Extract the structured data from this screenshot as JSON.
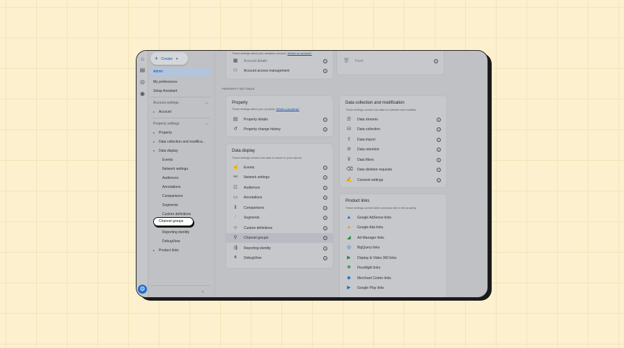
{
  "colors": {
    "background": "#fcf0cf",
    "accent": "#1f6fd1",
    "frame": "#bfc1c4"
  },
  "rail": {
    "icons": [
      "home-icon",
      "reports-icon",
      "explore-icon",
      "advertising-icon"
    ],
    "settings_icon": "gear-icon"
  },
  "sidebar": {
    "create_label": "Create",
    "admin": "Admin",
    "my_preferences": "My preferences",
    "setup_assistant": "Setup Assistant",
    "account_settings": "Account settings",
    "account": "Account",
    "property_settings": "Property settings",
    "property": "Property",
    "data_collection": "Data collection and modifica...",
    "data_display": "Data display",
    "sub_items": [
      "Events",
      "Network settings",
      "Audiences",
      "Annotations",
      "Comparisons",
      "Segments",
      "Custom definitions",
      "Channel groups",
      "Reporting identity",
      "DebugView"
    ],
    "product_links": "Product links"
  },
  "top_card": {
    "subtitle": "These settings affect your analytics account.",
    "subtitle_link": "What's an account?",
    "rows": [
      "Account details",
      "Account access management"
    ],
    "right_row": "Trash"
  },
  "property_settings_label": "PROPERTY SETTINGS",
  "property_card": {
    "title": "Property",
    "subtitle": "These settings affect your property.",
    "subtitle_link": "What's a property?",
    "rows": [
      "Property details",
      "Property change history"
    ]
  },
  "data_display_card": {
    "title": "Data display",
    "subtitle": "These settings control how data is shown in your reports",
    "rows": [
      "Events",
      "Network settings",
      "Audiences",
      "Annotations",
      "Comparisons",
      "Segments",
      "Custom definitions",
      "Channel groups",
      "Reporting identity",
      "DebugView"
    ]
  },
  "data_collection_card": {
    "title": "Data collection and modification",
    "subtitle": "These settings control how data is collected and modified",
    "rows": [
      "Data streams",
      "Data collection",
      "Data import",
      "Data retention",
      "Data filters",
      "Data deletion requests",
      "Consent settings"
    ]
  },
  "product_links_card": {
    "title": "Product links",
    "subtitle": "These settings control which products link to this property",
    "rows": [
      "Google AdSense links",
      "Google Ads links",
      "Ad Manager links",
      "BigQuery links",
      "Display & Video 360 links",
      "Floodlight links",
      "Merchant Center links",
      "Google Play links"
    ]
  }
}
